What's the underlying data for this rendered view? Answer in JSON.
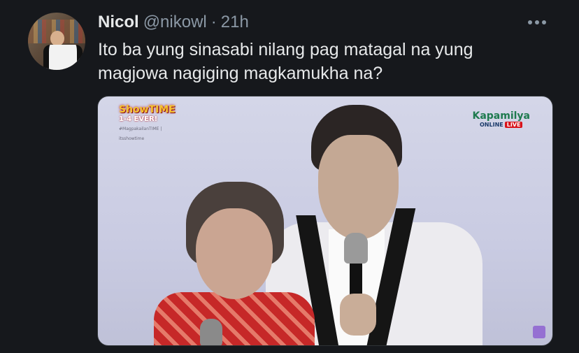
{
  "tweet": {
    "display_name": "Nicol",
    "handle": "@nikowl",
    "separator": "·",
    "time": "21h",
    "text": "Ito ba yung sinasabi nilang pag matagal na yung magjowa nagiging magkamukha na?"
  },
  "media": {
    "show_logo_text": "ShowTIME",
    "show_logo_sub": "1-4 EVER!",
    "show_logo_tag": "#MagpakailanTIME | itsshowtime",
    "broadcaster_brand": "Kapamilya",
    "broadcaster_status": "ONLINE",
    "broadcaster_live": "LIVE"
  },
  "icons": {
    "more": "more-horizontal-icon"
  },
  "colors": {
    "background": "#16181c",
    "text_primary": "#e7e9ea",
    "text_secondary": "#8b98a5"
  }
}
